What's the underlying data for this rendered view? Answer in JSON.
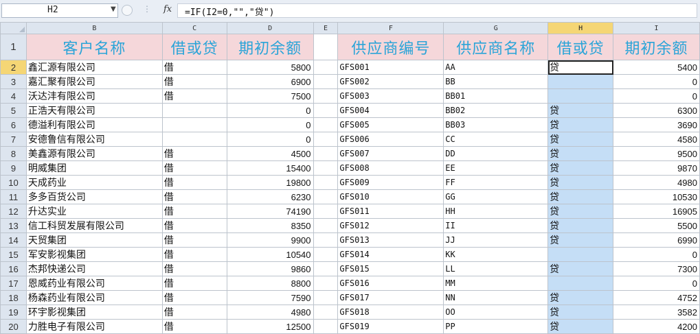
{
  "formula_bar": {
    "name_box": "H2",
    "formula": "=IF(I2=0,\"\",\"贷\")"
  },
  "columns": [
    "B",
    "C",
    "D",
    "E",
    "F",
    "G",
    "H",
    "I"
  ],
  "selected_column": "H",
  "headers": {
    "row_number": "1",
    "B": "客户名称",
    "C": "借或贷",
    "D": "期初余额",
    "E": "",
    "F": "供应商编号",
    "G": "供应商名称",
    "H": "借或贷",
    "I": "期初余额"
  },
  "rows": [
    {
      "n": "2",
      "b": "鑫汇源有限公司",
      "c": "借",
      "d": "5800",
      "f": "GFS001",
      "g": "AA",
      "h": "贷",
      "i": "5400"
    },
    {
      "n": "3",
      "b": "嘉汇聚有限公司",
      "c": "借",
      "d": "6900",
      "f": "GFS002",
      "g": "BB",
      "h": "",
      "i": "0"
    },
    {
      "n": "4",
      "b": "沃达沣有限公司",
      "c": "借",
      "d": "7500",
      "f": "GFS003",
      "g": "BB01",
      "h": "",
      "i": "0"
    },
    {
      "n": "5",
      "b": "正浩天有限公司",
      "c": "",
      "d": "0",
      "f": "GFS004",
      "g": "BB02",
      "h": "贷",
      "i": "6300"
    },
    {
      "n": "6",
      "b": "德溢利有限公司",
      "c": "",
      "d": "0",
      "f": "GFS005",
      "g": "BB03",
      "h": "贷",
      "i": "3690"
    },
    {
      "n": "7",
      "b": "安德鲁信有限公司",
      "c": "",
      "d": "0",
      "f": "GFS006",
      "g": "CC",
      "h": "贷",
      "i": "4580"
    },
    {
      "n": "8",
      "b": "美鑫源有限公司",
      "c": "借",
      "d": "4500",
      "f": "GFS007",
      "g": "DD",
      "h": "贷",
      "i": "9500"
    },
    {
      "n": "9",
      "b": "明威集团",
      "c": "借",
      "d": "15400",
      "f": "GFS008",
      "g": "EE",
      "h": "贷",
      "i": "9870"
    },
    {
      "n": "10",
      "b": "天成药业",
      "c": "借",
      "d": "19800",
      "f": "GFS009",
      "g": "FF",
      "h": "贷",
      "i": "4980"
    },
    {
      "n": "11",
      "b": "多多百货公司",
      "c": "借",
      "d": "6230",
      "f": "GFS010",
      "g": "GG",
      "h": "贷",
      "i": "10530"
    },
    {
      "n": "12",
      "b": "升达实业",
      "c": "借",
      "d": "74190",
      "f": "GFS011",
      "g": "HH",
      "h": "贷",
      "i": "16905"
    },
    {
      "n": "13",
      "b": "信工科贸发展有限公司",
      "c": "借",
      "d": "8350",
      "f": "GFS012",
      "g": "II",
      "h": "贷",
      "i": "5500"
    },
    {
      "n": "14",
      "b": "天贸集团",
      "c": "借",
      "d": "9900",
      "f": "GFS013",
      "g": "JJ",
      "h": "贷",
      "i": "6990"
    },
    {
      "n": "15",
      "b": "军安影视集团",
      "c": "借",
      "d": "10540",
      "f": "GFS014",
      "g": "KK",
      "h": "",
      "i": "0"
    },
    {
      "n": "16",
      "b": "杰邦快递公司",
      "c": "借",
      "d": "9860",
      "f": "GFS015",
      "g": "LL",
      "h": "贷",
      "i": "7300"
    },
    {
      "n": "17",
      "b": "恩威药业有限公司",
      "c": "借",
      "d": "8800",
      "f": "GFS016",
      "g": "MM",
      "h": "",
      "i": "0"
    },
    {
      "n": "18",
      "b": "杨森药业有限公司",
      "c": "借",
      "d": "7590",
      "f": "GFS017",
      "g": "NN",
      "h": "贷",
      "i": "4752"
    },
    {
      "n": "19",
      "b": "环宇影视集团",
      "c": "借",
      "d": "4980",
      "f": "GFS018",
      "g": "OO",
      "h": "贷",
      "i": "3582"
    },
    {
      "n": "20",
      "b": "力胜电子有限公司",
      "c": "借",
      "d": "12500",
      "f": "GFS019",
      "g": "PP",
      "h": "贷",
      "i": "4200"
    }
  ],
  "colors": {
    "header_fill": "#f5d7da",
    "header_text": "#2aa4d8",
    "selected_column_fill": "#c5def6",
    "selected_header": "#f5d675"
  }
}
